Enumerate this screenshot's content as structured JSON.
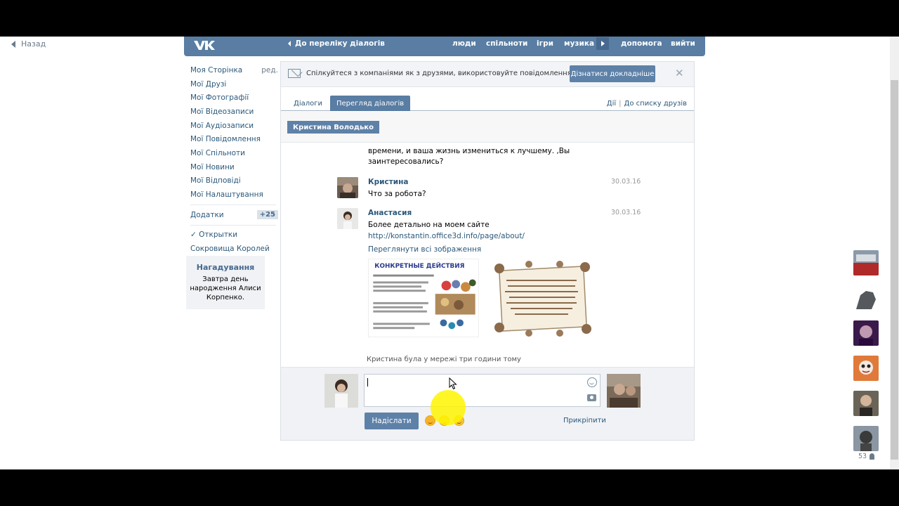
{
  "back": {
    "label": "Назад"
  },
  "topbar": {
    "back_to_dialogs": "До переліку діалогів",
    "nav": [
      "люди",
      "спільноти",
      "ігри",
      "музика",
      "допомога",
      "вийти"
    ]
  },
  "sidebar": {
    "items": [
      {
        "label": "Моя Сторінка",
        "edit": "ред."
      },
      {
        "label": "Мої Друзі"
      },
      {
        "label": "Мої Фотографії"
      },
      {
        "label": "Мої Відеозаписи"
      },
      {
        "label": "Мої Аудіозаписи"
      },
      {
        "label": "Мої Повідомлення"
      },
      {
        "label": "Мої Спільноти"
      },
      {
        "label": "Мої Новини"
      },
      {
        "label": "Мої Відповіді"
      },
      {
        "label": "Мої Налаштування"
      }
    ],
    "apps": {
      "label": "Додатки",
      "badge": "+25"
    },
    "extra": [
      "✓ Открытки",
      "Сокровища Королей"
    ]
  },
  "reminder": {
    "title": "Нагадування",
    "text_prefix": "Завтра ",
    "text_link": "день народження",
    "text_name": " Алиси Корпенко."
  },
  "promo": {
    "text": "Спілкуйтеся з компаніями як з друзями, використовуйте повідомлення.",
    "button": "Дізнатися докладніше",
    "close": "✕"
  },
  "tabs": {
    "dialogs": "Діалоги",
    "view": "Перегляд діалогів",
    "actions": "Дії",
    "friends_list": "До списку друзів"
  },
  "chip": {
    "name": "Кристина Володько"
  },
  "history": {
    "cont_text": "готовы помочь. От вас желание, обучаемость и немного времени, и ваша жизнь измениться к лучшему. ,Вы заинтересовались?",
    "messages": [
      {
        "name": "Кристина",
        "date": "30.03.16",
        "text": "Что за робота?"
      },
      {
        "name": "Анастасия",
        "date": "30.03.16",
        "text": "Более детально на моем сайте",
        "link": "http://konstantin.office3d.info/page/about/",
        "view_all": "Переглянути всі зображення"
      }
    ],
    "image_caption": "КОНКРЕТНЫЕ ДЕЙСТВИЯ",
    "status": "Кристина була у мережі три години тому"
  },
  "compose": {
    "send": "Надіслати",
    "attach": "Прикріпити"
  },
  "friends_online": {
    "count": "53"
  }
}
